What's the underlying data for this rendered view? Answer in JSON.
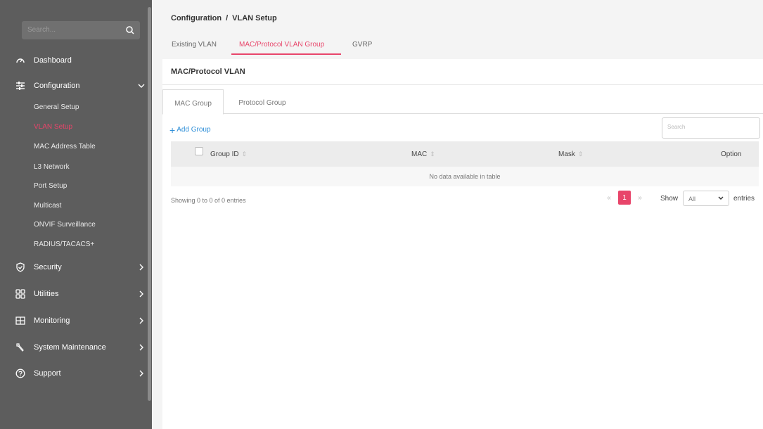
{
  "sidebar": {
    "search_placeholder": "Search...",
    "items": [
      {
        "label": "Dashboard",
        "icon": "dashboard-icon"
      },
      {
        "label": "Configuration",
        "icon": "configuration-icon",
        "expanded": true
      },
      {
        "label": "Security",
        "icon": "shield-icon"
      },
      {
        "label": "Utilities",
        "icon": "utilities-icon"
      },
      {
        "label": "Monitoring",
        "icon": "monitoring-icon"
      },
      {
        "label": "System Maintenance",
        "icon": "wrench-icon"
      },
      {
        "label": "Support",
        "icon": "help-icon"
      }
    ],
    "config_sub": [
      {
        "label": "General Setup"
      },
      {
        "label": "VLAN Setup",
        "active": true
      },
      {
        "label": "MAC Address Table"
      },
      {
        "label": "L3 Network"
      },
      {
        "label": "Port Setup"
      },
      {
        "label": "Multicast"
      },
      {
        "label": "ONVIF Surveillance"
      },
      {
        "label": "RADIUS/TACACS+"
      }
    ]
  },
  "breadcrumb": {
    "section": "Configuration",
    "separator": "/",
    "page": "VLAN Setup"
  },
  "top_tabs": [
    {
      "label": "Existing VLAN"
    },
    {
      "label": "MAC/Protocol VLAN Group",
      "active": true
    },
    {
      "label": "GVRP"
    }
  ],
  "panel": {
    "title": "MAC/Protocol VLAN",
    "tabs": [
      {
        "label": "MAC Group",
        "active": true
      },
      {
        "label": "Protocol Group"
      }
    ],
    "add_label": "Add Group",
    "search_placeholder": "Search",
    "table": {
      "columns": [
        "Group ID",
        "MAC",
        "Mask",
        "Option"
      ],
      "empty_message": "No data available in table"
    },
    "showing": "Showing 0 to 0 of 0 entries",
    "pagination": {
      "prev": "«",
      "current": "1",
      "next": "»"
    },
    "show_label": "Show",
    "entries_value": "All",
    "entries_label": "entries"
  },
  "colors": {
    "accent": "#e8456a",
    "link": "#2f8fd8",
    "sidebar": "#5d5d5d"
  }
}
